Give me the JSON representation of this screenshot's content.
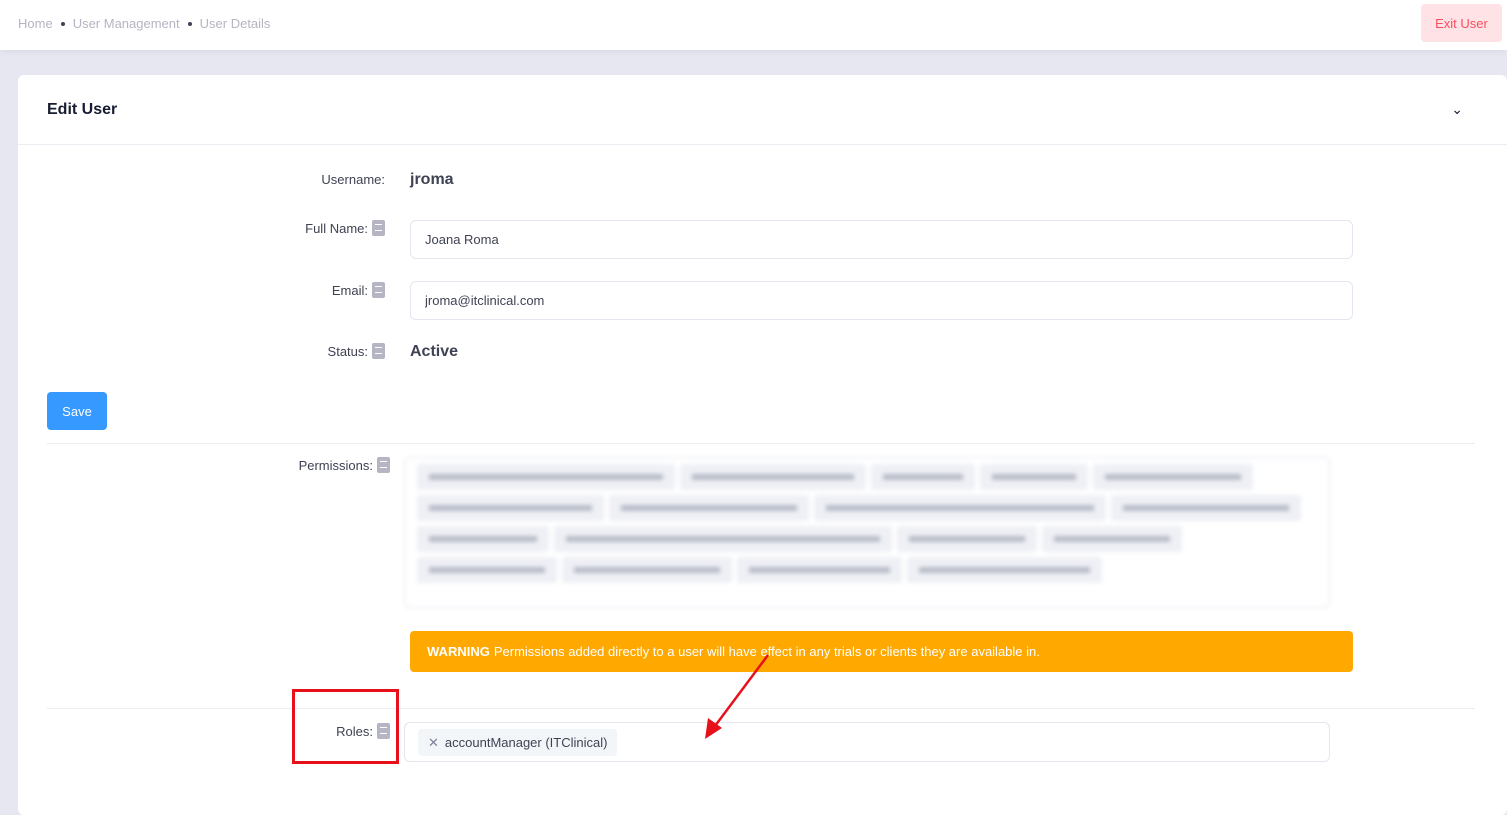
{
  "breadcrumb": [
    "Home",
    "User Management",
    "User Details"
  ],
  "exit_label": "Exit User",
  "card": {
    "title": "Edit User"
  },
  "form": {
    "username_label": "Username:",
    "username": "jroma",
    "fullname_label": "Full Name:",
    "fullname": "Joana Roma",
    "email_label": "Email:",
    "email": "jroma@itclinical.com",
    "status_label": "Status:",
    "status": "Active",
    "save_label": "Save"
  },
  "permissions": {
    "label": "Permissions:"
  },
  "warning": {
    "strong": "WARNING",
    "text": "Permissions added directly to a user will have effect in any trials or clients they are available in."
  },
  "roles": {
    "label": "Roles:",
    "items": [
      "accountManager (ITClinical)"
    ]
  },
  "colors": {
    "primary": "#3699ff",
    "warning": "#ffa800",
    "danger": "#f64e60",
    "annotation": "#e8111b"
  }
}
